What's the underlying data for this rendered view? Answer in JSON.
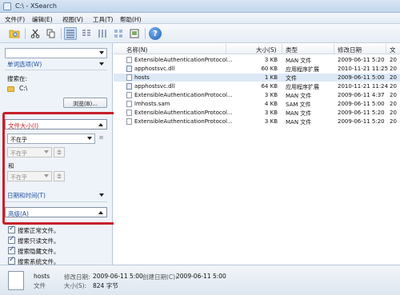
{
  "window": {
    "title": "C:\\ - XSearch"
  },
  "menu": [
    "文件(F)",
    "编辑(E)",
    "视图(V)",
    "工具(T)",
    "帮助(H)"
  ],
  "toolbar": {
    "icons": [
      "folder-search-icon",
      "cut-icon",
      "copy-icon",
      "details-view-icon",
      "list-view-icon",
      "columns-view-icon",
      "thumbnails-view-icon",
      "preview-view-icon",
      "help-icon"
    ],
    "help_glyph": "?"
  },
  "left": {
    "top_combo_value": "",
    "word_options": "单词选项(W)",
    "search_in_label": "搜索在:",
    "search_in_value": "C:\\",
    "browse_label": "浏览(B)...",
    "file_size_header": "文件大小(I)",
    "size_condition": "不在乎",
    "size_value": "不在乎",
    "and_label": "和",
    "size_value2": "不在乎",
    "date_header": "日期和时间(T)",
    "advanced_header": "高级(A)",
    "checkboxes": [
      "搜索正常文件。",
      "搜索只读文件。",
      "搜索隐藏文件。",
      "搜索系统文件。"
    ]
  },
  "list": {
    "columns": [
      "名称(N)",
      "大小(S)",
      "类型",
      "修改日期",
      "文"
    ],
    "rows": [
      {
        "name": "ExtensibleAuthenticationProtocol...",
        "size": "3 KB",
        "type": "MAN 文件",
        "modified": "2009-06-11 5:20",
        "extra": "20",
        "icon": "file-icon",
        "selected": false
      },
      {
        "name": "apphostsvc.dll",
        "size": "60 KB",
        "type": "应用程序扩展",
        "modified": "2010-11-21 11:25",
        "extra": "20",
        "icon": "dll-icon",
        "selected": false
      },
      {
        "name": "hosts",
        "size": "1 KB",
        "type": "文件",
        "modified": "2009-06-11 5:00",
        "extra": "20",
        "icon": "file-icon",
        "selected": true
      },
      {
        "name": "apphostsvc.dll",
        "size": "64 KB",
        "type": "应用程序扩展",
        "modified": "2010-11-21 11:24",
        "extra": "20",
        "icon": "dll-icon",
        "selected": false
      },
      {
        "name": "ExtensibleAuthenticationProtocol...",
        "size": "3 KB",
        "type": "MAN 文件",
        "modified": "2009-06-11 4:37",
        "extra": "20",
        "icon": "file-icon",
        "selected": false
      },
      {
        "name": "lmhosts.sam",
        "size": "4 KB",
        "type": "SAM 文件",
        "modified": "2009-06-11 5:00",
        "extra": "20",
        "icon": "file-icon",
        "selected": false
      },
      {
        "name": "ExtensibleAuthenticationProtocol...",
        "size": "3 KB",
        "type": "MAN 文件",
        "modified": "2009-06-11 5:20",
        "extra": "20",
        "icon": "file-icon",
        "selected": false
      },
      {
        "name": "ExtensibleAuthenticationProtocol...",
        "size": "3 KB",
        "type": "MAN 文件",
        "modified": "2009-06-11 5:20",
        "extra": "20",
        "icon": "file-icon",
        "selected": false
      }
    ]
  },
  "status": {
    "file_name": "hosts",
    "file_type": "文件",
    "modified_label": "修改日期:",
    "modified_value": "2009-06-11 5:00",
    "created_label": "创建日期(C):",
    "created_value": "2009-06-11 5:00",
    "size_label": "大小(S):",
    "size_value": "824 字节"
  },
  "colors": {
    "highlight_frame": "#c8202a",
    "section_text": "#1f4fa0",
    "selection": "#dce8f6"
  }
}
